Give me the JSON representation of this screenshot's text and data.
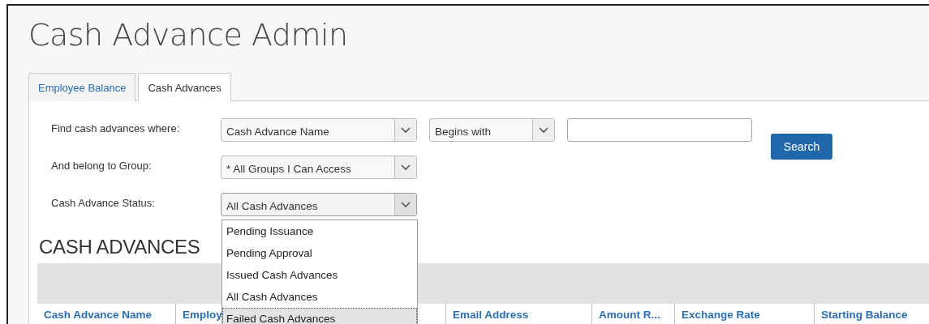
{
  "page_title": "Cash Advance Admin",
  "tabs": [
    {
      "label": "Employee Balance",
      "selected": false
    },
    {
      "label": "Cash Advances",
      "selected": true
    }
  ],
  "filters": [
    {
      "label": "Find cash advances where:",
      "select": "Cash Advance Name",
      "operator": "Begins with",
      "has_input": true
    },
    {
      "label": "And belong to Group:",
      "select": "* All Groups I Can Access"
    },
    {
      "label": "Cash Advance Status:",
      "select": "All Cash Advances",
      "expanded": true
    }
  ],
  "search_button": "Search",
  "status_options": [
    {
      "label": "Pending Issuance",
      "selected": false
    },
    {
      "label": "Pending Approval",
      "selected": false
    },
    {
      "label": "Issued Cash Advances",
      "selected": false
    },
    {
      "label": "All Cash Advances",
      "selected": false
    },
    {
      "label": "Failed Cash Advances",
      "selected": true
    }
  ],
  "section_title": "CASH ADVANCES",
  "table": {
    "columns": [
      "Cash Advance Name",
      "Employ",
      "Email Address",
      "Amount R...",
      "Exchange Rate",
      "Starting Balance"
    ]
  }
}
